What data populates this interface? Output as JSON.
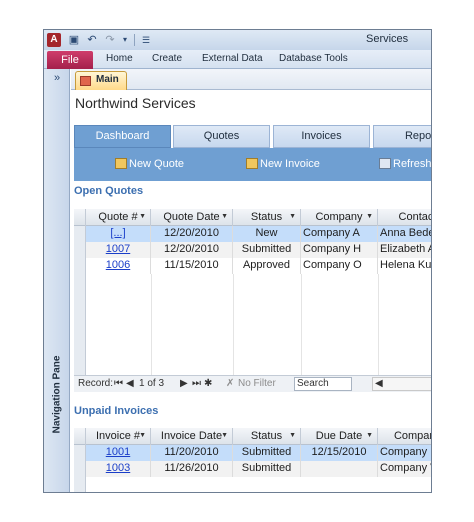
{
  "window": {
    "title": "Services"
  },
  "quick_access": {
    "app_icon_letter": "A",
    "save_icon": "save-icon",
    "undo_icon": "undo-icon",
    "redo_icon": "redo-icon",
    "customize_icon": "customize-icon"
  },
  "ribbon": {
    "tabs": [
      "File",
      "Home",
      "Create",
      "External Data",
      "Database Tools"
    ],
    "active": "File"
  },
  "nav_pane": {
    "label": "Navigation Pane",
    "toggle_glyph": "»"
  },
  "document_tab": {
    "label": "Main"
  },
  "form": {
    "title": "Northwind Services",
    "tabs": [
      "Dashboard",
      "Quotes",
      "Invoices",
      "Report"
    ],
    "active_tab": "Dashboard",
    "commands": [
      "New Quote",
      "New Invoice",
      "Refresh"
    ]
  },
  "open_quotes": {
    "label": "Open Quotes",
    "columns": [
      "Quote #",
      "Quote Date",
      "Status",
      "Company",
      "Contact"
    ],
    "rows": [
      [
        "[...]",
        "12/20/2010",
        "New",
        "Company A",
        "Anna Bede"
      ],
      [
        "1007",
        "12/20/2010",
        "Submitted",
        "Company H",
        "Elizabeth A"
      ],
      [
        "1006",
        "11/15/2010",
        "Approved",
        "Company O",
        "Helena Ku"
      ]
    ],
    "navigator": {
      "record_label": "Record:",
      "position": "1 of 3",
      "filter": "No Filter",
      "search_placeholder": "Search"
    }
  },
  "unpaid_invoices": {
    "label": "Unpaid Invoices",
    "columns": [
      "Invoice #",
      "Invoice Date",
      "Status",
      "Due Date",
      "Company"
    ],
    "rows": [
      [
        "1001",
        "11/20/2010",
        "Submitted",
        "12/15/2010",
        "Company F"
      ],
      [
        "1003",
        "11/26/2010",
        "Submitted",
        "",
        "Company V"
      ]
    ]
  },
  "colors": {
    "accent": "#6f9fd2",
    "file_tab": "#b72a57",
    "link": "#1a3ec9",
    "section_label": "#3c6fb0",
    "selected_row": "#c4ddfa"
  }
}
